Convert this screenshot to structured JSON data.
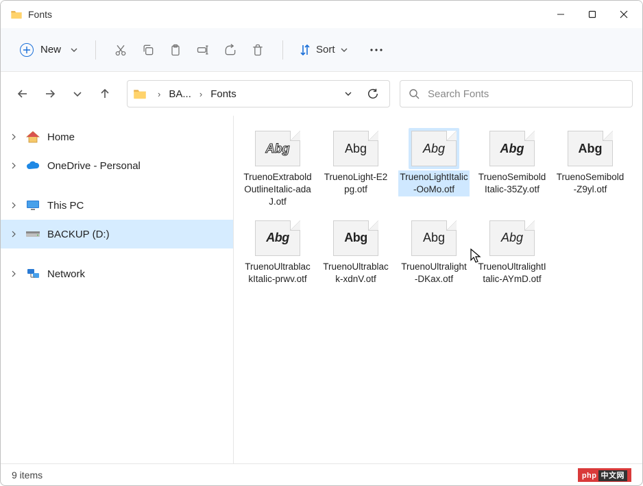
{
  "window": {
    "title": "Fonts"
  },
  "toolbar": {
    "new_label": "New",
    "sort_label": "Sort"
  },
  "breadcrumb": {
    "items": [
      "BA...",
      "Fonts"
    ]
  },
  "search": {
    "placeholder": "Search Fonts"
  },
  "sidebar": {
    "items": [
      {
        "label": "Home"
      },
      {
        "label": "OneDrive - Personal"
      },
      {
        "label": "This PC"
      },
      {
        "label": "BACKUP (D:)"
      },
      {
        "label": "Network"
      }
    ]
  },
  "files": [
    {
      "name": "TruenoExtraboldOutlineItalic-adaJ.otf",
      "style": "outline",
      "selected": false
    },
    {
      "name": "TruenoLight-E2pg.otf",
      "style": "light",
      "selected": false
    },
    {
      "name": "TruenoLightItalic-OoMo.otf",
      "style": "light-italic",
      "selected": true
    },
    {
      "name": "TruenoSemiboldItalic-35Zy.otf",
      "style": "bold-italic",
      "selected": false
    },
    {
      "name": "TruenoSemibold-Z9yl.otf",
      "style": "bold",
      "selected": false
    },
    {
      "name": "TruenoUltrablackItalic-prwv.otf",
      "style": "black-italic",
      "selected": false
    },
    {
      "name": "TruenoUltrablack-xdnV.otf",
      "style": "black",
      "selected": false
    },
    {
      "name": "TruenoUltralight-DKax.otf",
      "style": "thin",
      "selected": false
    },
    {
      "name": "TruenoUltralightItalic-AYmD.otf",
      "style": "thin-italic",
      "selected": false
    }
  ],
  "status": {
    "items_label": "9 items"
  },
  "badge": {
    "left": "php",
    "right": "中文网"
  }
}
